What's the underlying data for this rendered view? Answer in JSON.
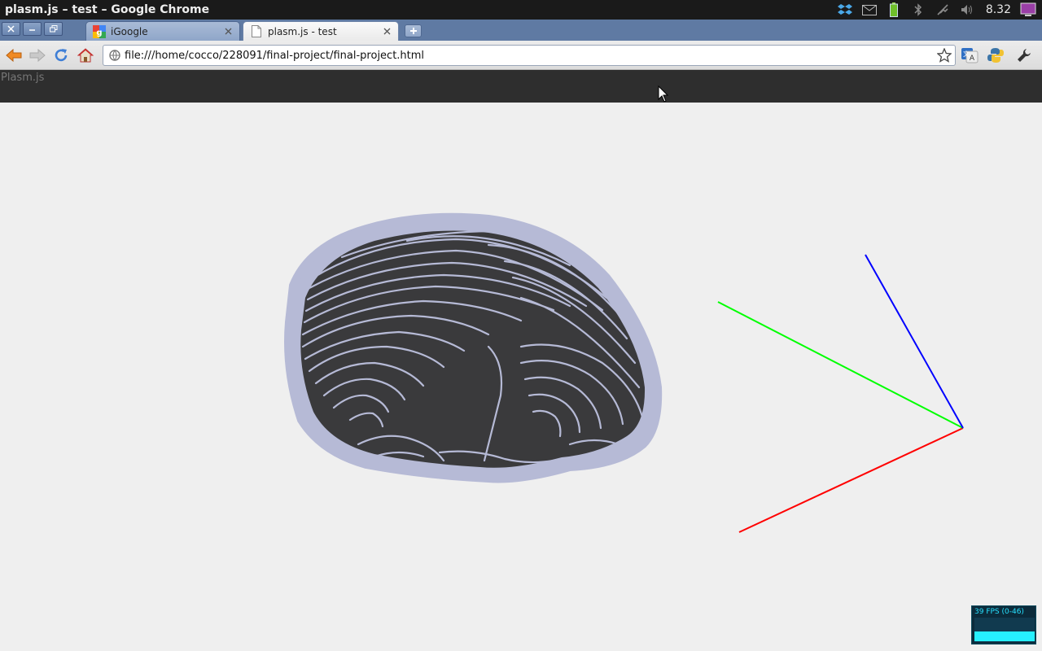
{
  "os": {
    "window_title": "plasm.js – test – Google Chrome",
    "clock": "8.32",
    "tray_icons": [
      "dropbox-icon",
      "mail-icon",
      "battery-icon",
      "bluetooth-icon",
      "network-icon",
      "volume-icon",
      "display-icon"
    ]
  },
  "tabs": [
    {
      "label": "iGoogle",
      "icon": "google-favicon",
      "active": false
    },
    {
      "label": "plasm.js - test",
      "icon": "page-icon",
      "active": true
    }
  ],
  "toolbar": {
    "url": "file:///home/cocco/228091/final-project/final-project.html"
  },
  "app": {
    "title": "Plasm.js"
  },
  "fps_meter": {
    "text": "39 FPS (0-46)",
    "fps": 39,
    "max": 46
  },
  "colors": {
    "axis_x": "#ff0000",
    "axis_y": "#00ff00",
    "axis_z": "#0000ff",
    "mesh_fill": "#3a3a3c",
    "mesh_lines": "#b6bad6"
  }
}
